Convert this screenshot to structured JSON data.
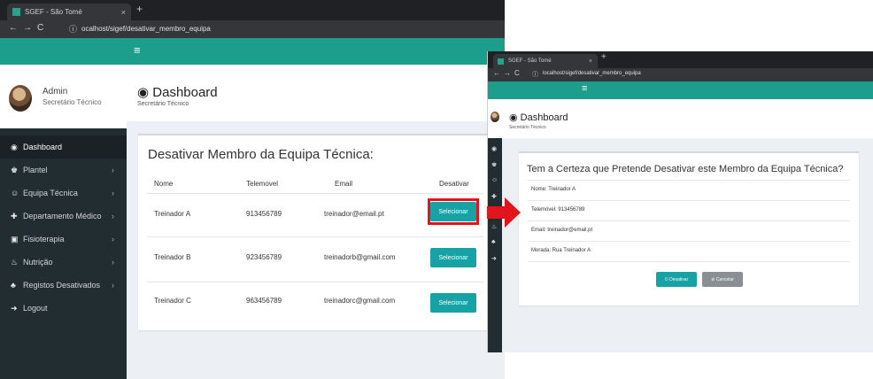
{
  "left_window": {
    "tab_title": "SGEF - São Tomé",
    "tab_close": "×",
    "new_tab": "+",
    "nav": {
      "back": "←",
      "forward": "→",
      "reload": "C",
      "info": "ⓘ"
    },
    "url": "ocalhost/sigef/desativar_membro_equipa",
    "hamburger": "≡",
    "user": {
      "name": "Admin",
      "role": "Secretário Técnico"
    },
    "menu": [
      {
        "label": "Dashboard",
        "icon": "dashboard-icon",
        "glyph": "◉",
        "has_chevron": false
      },
      {
        "label": "Plantel",
        "icon": "shirt-icon",
        "glyph": "♚",
        "has_chevron": true
      },
      {
        "label": "Equipa Técnica",
        "icon": "team-icon",
        "glyph": "☺",
        "has_chevron": true
      },
      {
        "label": "Departamento Médico",
        "icon": "medical-icon",
        "glyph": "✚",
        "has_chevron": true
      },
      {
        "label": "Fisioterapia",
        "icon": "physio-icon",
        "glyph": "▣",
        "has_chevron": true
      },
      {
        "label": "Nutrição",
        "icon": "nutrition-icon",
        "glyph": "♨",
        "has_chevron": true
      },
      {
        "label": "Registos Desativados",
        "icon": "archive-icon",
        "glyph": "♣",
        "has_chevron": true
      },
      {
        "label": "Logout",
        "icon": "logout-icon",
        "glyph": "➜",
        "has_chevron": false
      }
    ],
    "page_title": "Dashboard",
    "page_subtitle": "Secretário Técnico",
    "box_title": "Desativar Membro da Equipa Técnica:",
    "table": {
      "headers": [
        "Nome",
        "Telemovel",
        "Email",
        "Desativar"
      ],
      "rows": [
        {
          "nome": "Treinador A",
          "telemovel": "913456789",
          "email": "treinador@email.pt",
          "action": "Selecionar"
        },
        {
          "nome": "Treinador B",
          "telemovel": "923456789",
          "email": "treinadorb@gmail.com",
          "action": "Selecionar"
        },
        {
          "nome": "Treinador C",
          "telemovel": "963456789",
          "email": "treinadorc@gmail.com",
          "action": "Selecionar"
        }
      ]
    }
  },
  "right_window": {
    "tab_title": "SGEF - São Tomé",
    "tab_close": "×",
    "new_tab": "+",
    "nav": {
      "back": "←",
      "forward": "→",
      "reload": "C",
      "info": "ⓘ"
    },
    "url": "localhost/sigef/desativar_membro_equipa",
    "hamburger": "≡",
    "page_title": "Dashboard",
    "page_subtitle": "Secretário Técnico",
    "confirm_title": "Tem a Certeza que Pretende Desativar este Membro da Equipa Técnica?",
    "details": [
      "Nome: Treinador A",
      "Telemóvel: 913456789",
      "Email: treinador@email.pt",
      "Morada: Rua Treinador A"
    ],
    "buttons": {
      "deactivate": "Desativar",
      "cancel": "Cancelar"
    }
  },
  "colors": {
    "accent": "#1d9e8c",
    "sidebar": "#222d32",
    "select_button": "#17a2a5",
    "highlight": "#e3151c",
    "cancel_button": "#8a8f94"
  }
}
